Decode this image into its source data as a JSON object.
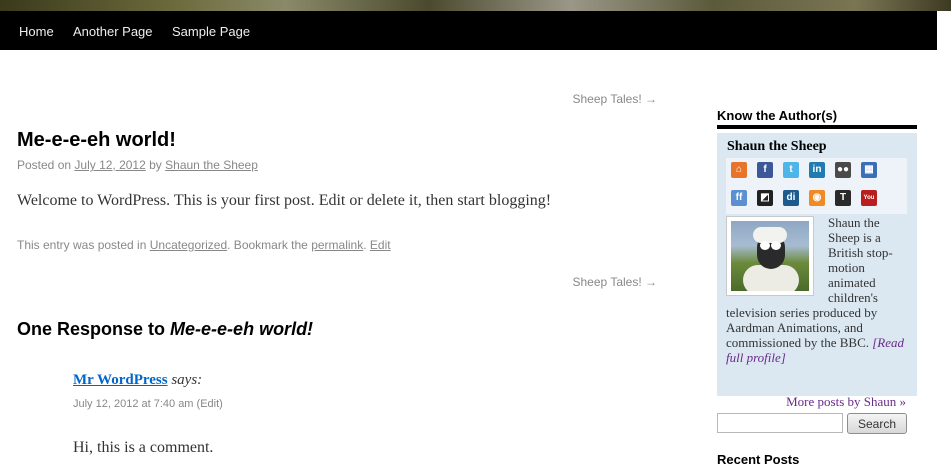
{
  "nav": {
    "items": [
      "Home",
      "Another Page",
      "Sample Page"
    ]
  },
  "post_nav": {
    "top_link": "Sheep Tales! →",
    "bottom_link": "Sheep Tales! →"
  },
  "post": {
    "title": "Me-e-e-eh world!",
    "posted_on_label": "Posted on",
    "date": "July 12, 2012",
    "by_label": "by",
    "author": "Shaun the Sheep",
    "body": "Welcome to WordPress. This is your first post. Edit or delete it, then start blogging!",
    "utility": {
      "posted_in_label": "This entry was posted in",
      "category": "Uncategorized",
      "bookmark_label": ". Bookmark the",
      "permalink": "permalink",
      "sep": ".",
      "edit": "Edit"
    }
  },
  "responses": {
    "title_prefix": "One Response to",
    "title_post": "Me-e-e-eh world!"
  },
  "comment": {
    "author": "Mr WordPress",
    "says": "says:",
    "timestamp": "July 12, 2012 at 7:40 am",
    "edit": "(Edit)",
    "body": "Hi, this is a comment."
  },
  "sidebar": {
    "author_widget_title": "Know the Author(s)",
    "author_name": "Shaun the Sheep",
    "social_icons": [
      {
        "name": "home-icon",
        "glyph": "⌂",
        "color": "#e8742a"
      },
      {
        "name": "facebook-icon",
        "glyph": "f",
        "color": "#3b5998"
      },
      {
        "name": "twitter-icon",
        "glyph": "t",
        "color": "#4fb4e8"
      },
      {
        "name": "linkedin-icon",
        "glyph": "in",
        "color": "#1f7bb0"
      },
      {
        "name": "flickr-icon",
        "glyph": "●●",
        "color": "#4a4a4a"
      },
      {
        "name": "delicious-grid-icon",
        "glyph": "▦",
        "color": "#3a6fb8"
      },
      {
        "name": "friendfeed-icon",
        "glyph": "ff",
        "color": "#5b8fd0"
      },
      {
        "name": "delicious-icon",
        "glyph": "◩",
        "color": "#222222"
      },
      {
        "name": "digg-icon",
        "glyph": "di",
        "color": "#1d5a8e"
      },
      {
        "name": "rss-icon",
        "glyph": "◉",
        "color": "#f08a24"
      },
      {
        "name": "technorati-icon",
        "glyph": "T",
        "color": "#2a2a2a"
      },
      {
        "name": "youtube-icon",
        "glyph": "You",
        "color": "#b81e1e"
      }
    ],
    "bio": "Shaun the Sheep is a British stop-motion animated children's television series produced by Aardman Animations, and commissioned by the BBC.",
    "read_more": "[Read full profile]",
    "more_posts": "More posts by Shaun »",
    "search_button": "Search",
    "search_value": "",
    "recent_posts_title": "Recent Posts"
  }
}
